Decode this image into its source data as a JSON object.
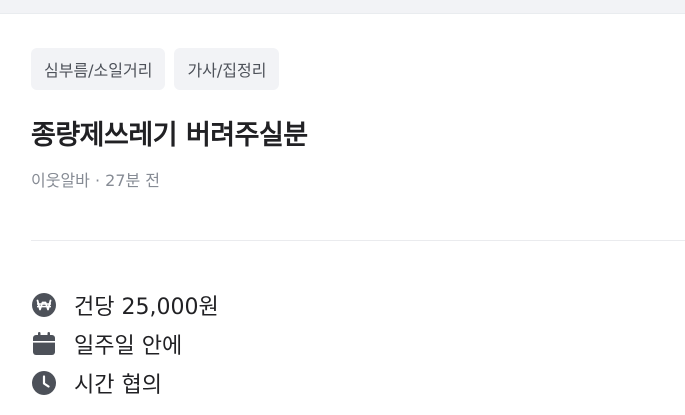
{
  "tags": [
    {
      "label": "심부름/소일거리"
    },
    {
      "label": "가사/집정리"
    }
  ],
  "post": {
    "title": "종량제쓰레기 버려주실분",
    "meta": "이웃알바 · 27분 전"
  },
  "info": [
    {
      "icon": "won-coin-icon",
      "text": "건당 25,000원"
    },
    {
      "icon": "calendar-icon",
      "text": "일주일 안에"
    },
    {
      "icon": "clock-icon",
      "text": "시간 협의"
    }
  ],
  "colors": {
    "icon": "#4d5159",
    "tag_bg": "#f2f3f6",
    "meta_text": "#868b94"
  }
}
